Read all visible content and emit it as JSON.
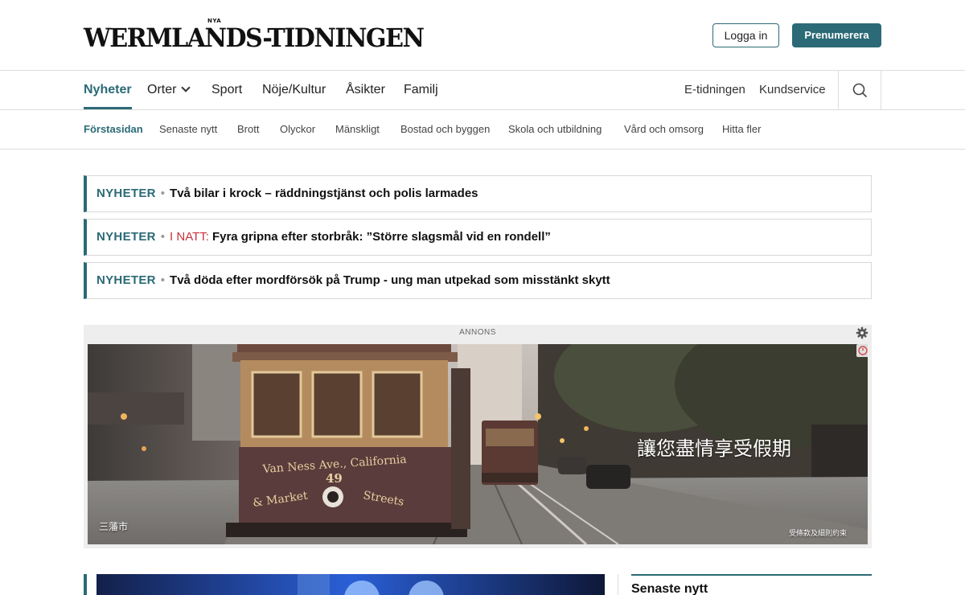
{
  "header": {
    "logo_text": "WERMLANDS-TIDNINGEN",
    "logo_small": "NYA",
    "login_label": "Logga in",
    "subscribe_label": "Prenumerera"
  },
  "nav": {
    "items": [
      {
        "label": "Nyheter"
      },
      {
        "label": "Orter"
      },
      {
        "label": "Sport"
      },
      {
        "label": "Nöje/Kultur"
      },
      {
        "label": "Åsikter"
      },
      {
        "label": "Familj"
      }
    ],
    "right": [
      {
        "label": "E-tidningen"
      },
      {
        "label": "Kundservice"
      }
    ]
  },
  "subnav": {
    "items": [
      {
        "label": "Förstasidan"
      },
      {
        "label": "Senaste nytt"
      },
      {
        "label": "Brott"
      },
      {
        "label": "Olyckor"
      },
      {
        "label": "Mänskligt"
      },
      {
        "label": "Bostad och byggen"
      },
      {
        "label": "Skola och utbildning"
      },
      {
        "label": "Vård och omsorg"
      },
      {
        "label": "Hitta fler"
      }
    ]
  },
  "headlines": [
    {
      "section": "NYHETER",
      "tag": "",
      "title": "Två bilar i krock – räddningstjänst och polis larmades"
    },
    {
      "section": "NYHETER",
      "tag": "I NATT:",
      "title": "Fyra gripna efter storbråk: ”Större slagsmål vid en rondell”"
    },
    {
      "section": "NYHETER",
      "tag": "",
      "title": "Två döda efter mordförsök på Trump - ung man utpekad som misstänkt skytt"
    }
  ],
  "ad": {
    "label": "ANNONS",
    "caption": "讓您盡情享受假期",
    "city": "三藩市",
    "terms": "受條款及細則約束",
    "tram_sign_1": "Van Ness Ave., California",
    "tram_number": "49",
    "tram_sign_2": "& Market",
    "tram_sign_3": "Streets"
  },
  "latest": {
    "title": "Senaste nytt"
  },
  "colors": {
    "accent": "#2b6a76",
    "breaking": "#c8323c"
  }
}
